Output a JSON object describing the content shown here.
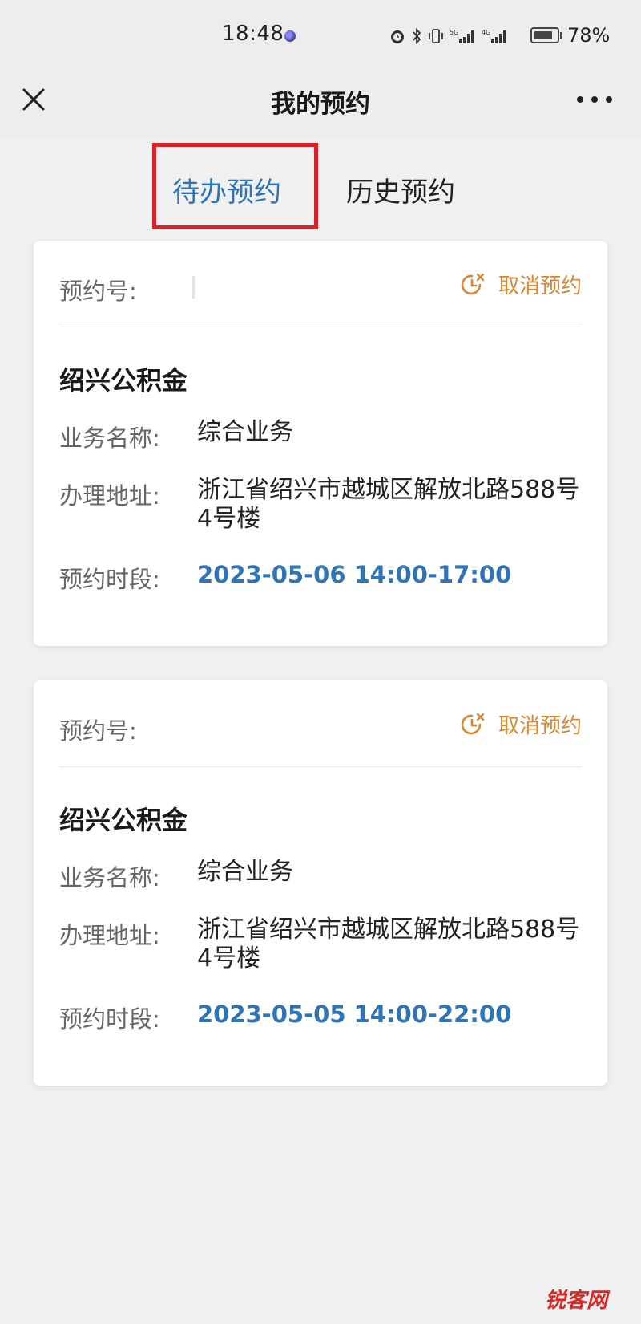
{
  "status_bar": {
    "time": "18:48",
    "battery": "78%"
  },
  "nav": {
    "title": "我的预约",
    "close_icon": "close-icon",
    "more_icon": "more-icon"
  },
  "tabs": [
    {
      "label": "待办预约",
      "active": true
    },
    {
      "label": "历史预约",
      "active": false
    }
  ],
  "colors": {
    "accent_blue": "#2f74b6",
    "cancel_orange": "#dc8530",
    "highlight_red": "#d8222a"
  },
  "appointments": [
    {
      "number_label": "预约号:",
      "cancel_label": "取消预约",
      "org": "绍兴公积金",
      "business_label": "业务名称:",
      "business_value": "综合业务",
      "address_label": "办理地址:",
      "address_value": "浙江省绍兴市越城区解放北路588号4号楼",
      "time_label": "预约时段:",
      "time_value": "2023-05-06 14:00-17:00"
    },
    {
      "number_label": "预约号:",
      "cancel_label": "取消预约",
      "org": "绍兴公积金",
      "business_label": "业务名称:",
      "business_value": "综合业务",
      "address_label": "办理地址:",
      "address_value": "浙江省绍兴市越城区解放北路588号4号楼",
      "time_label": "预约时段:",
      "time_value": "2023-05-05 14:00-22:00"
    }
  ],
  "watermark": "锐客网"
}
